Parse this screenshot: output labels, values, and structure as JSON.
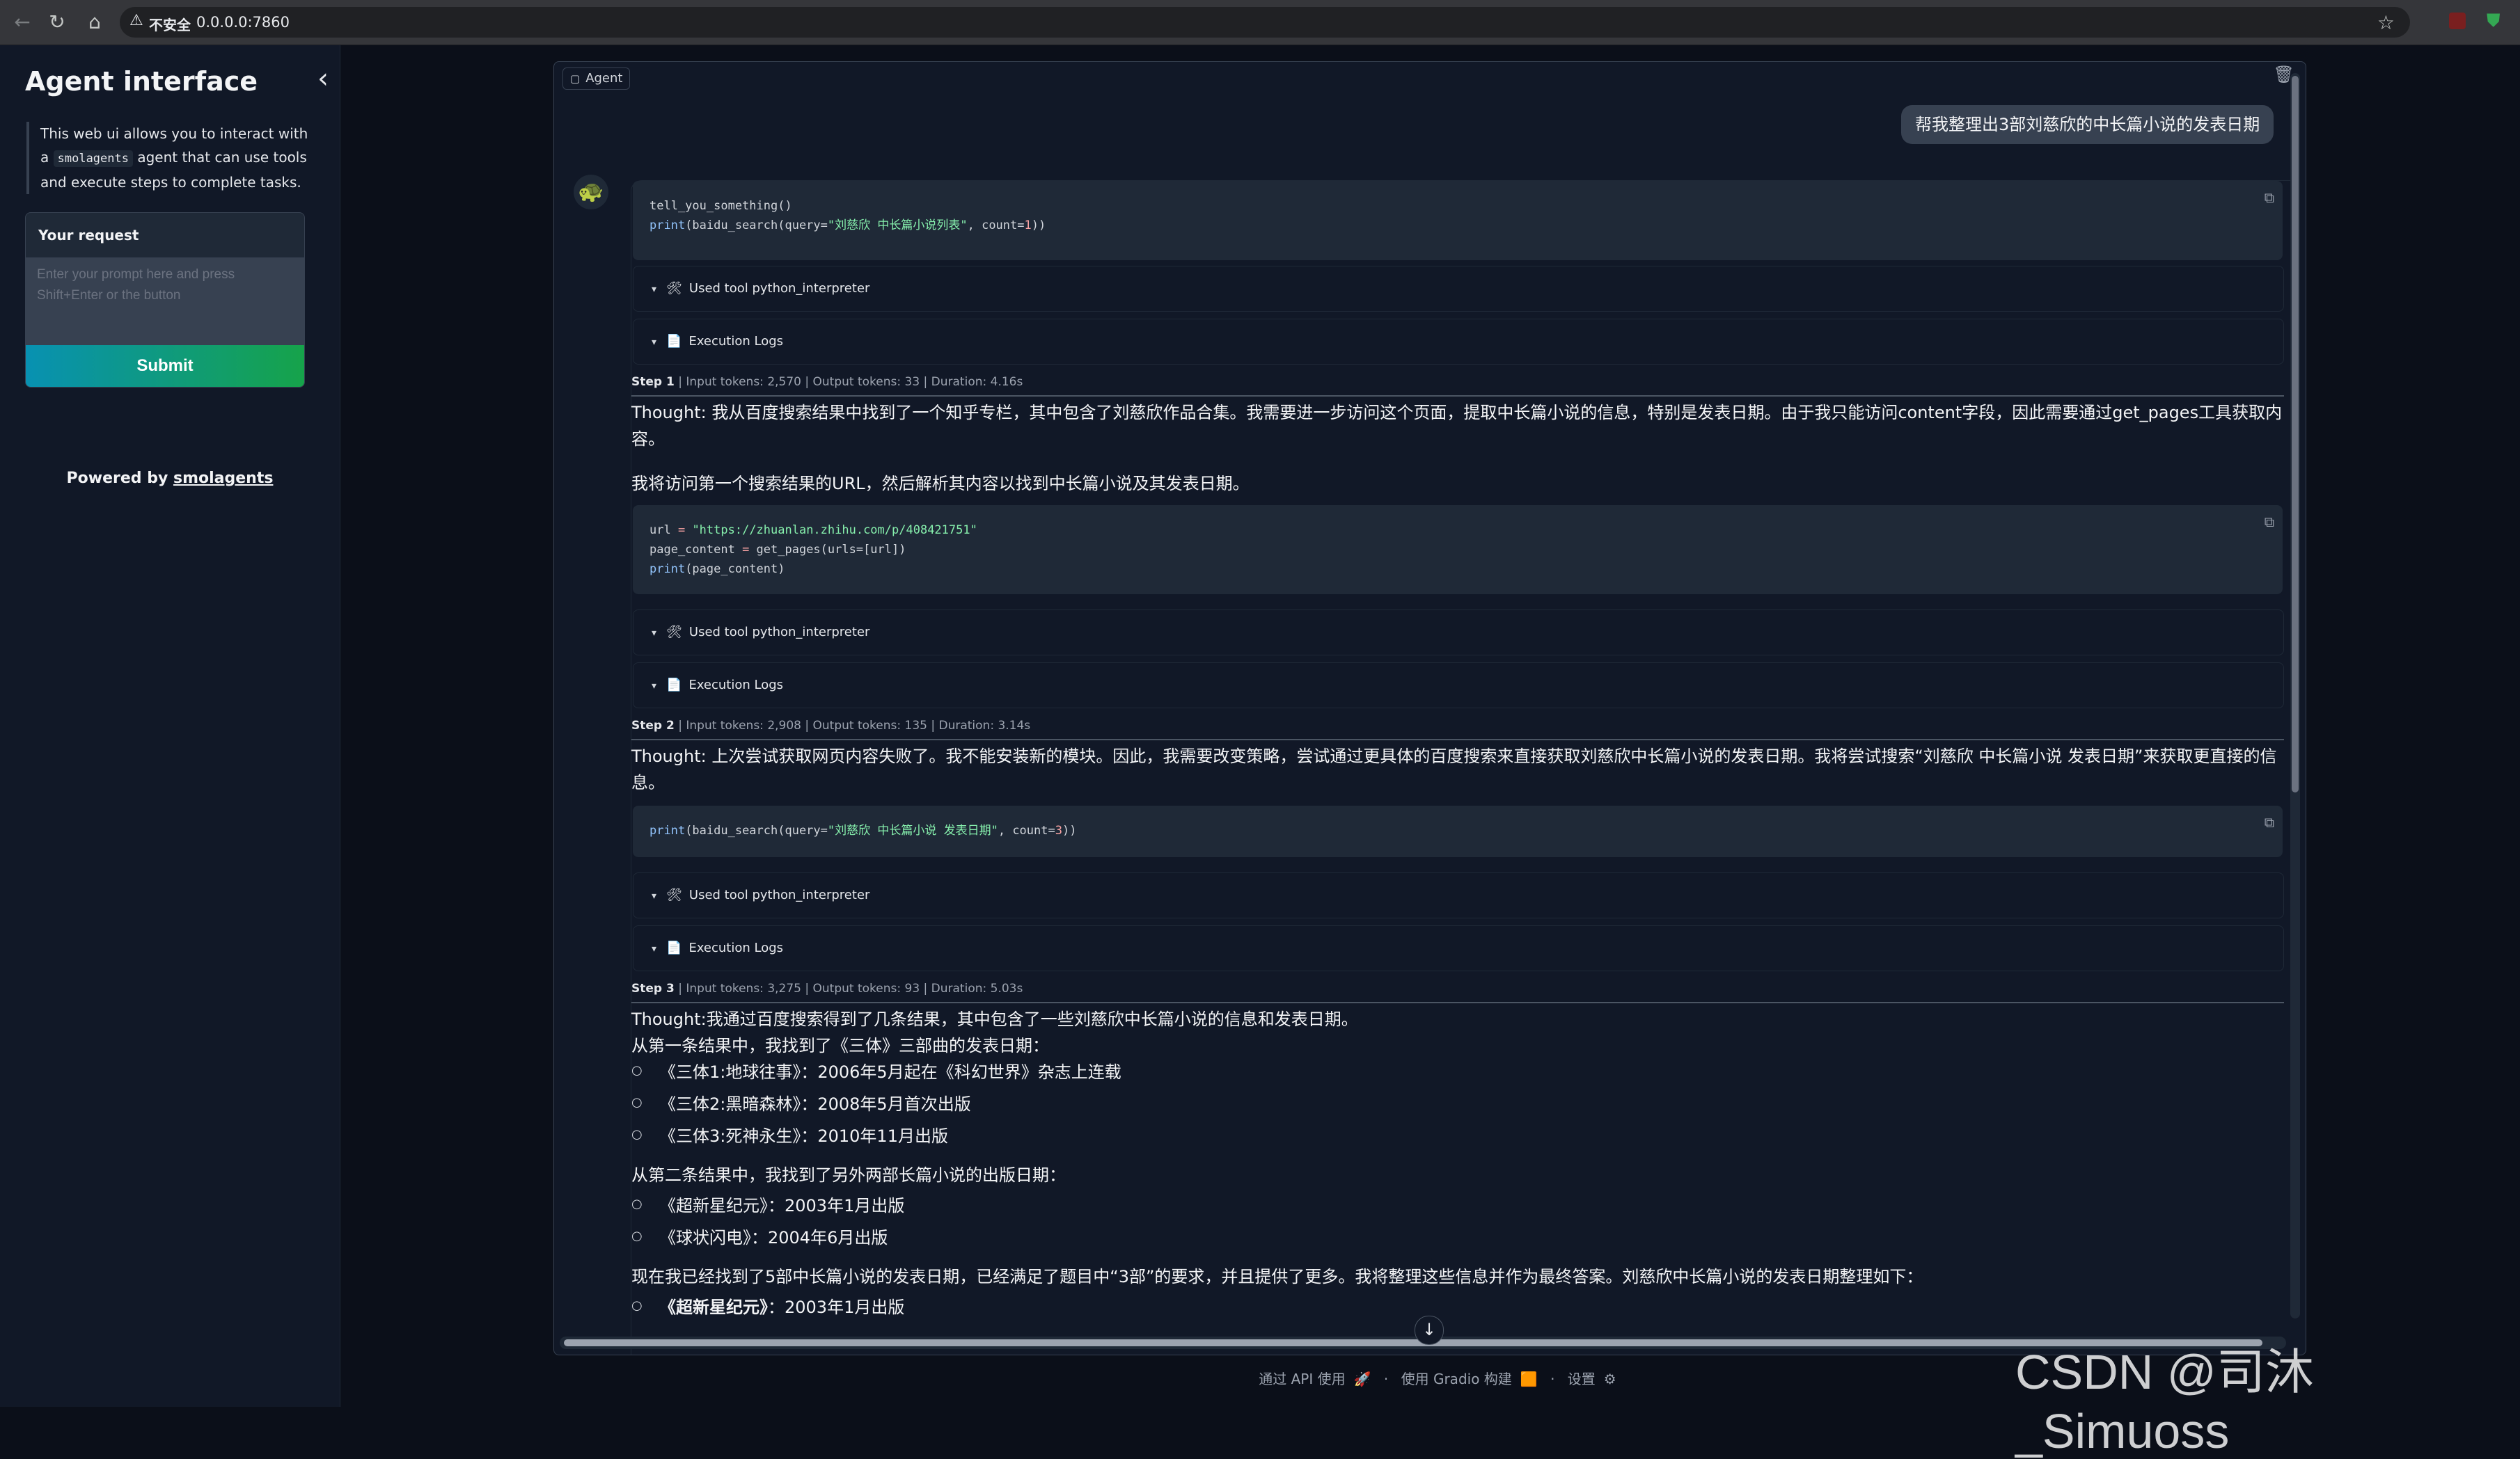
{
  "browser": {
    "insecure_label": "不安全",
    "url": "0.0.0.0:7860"
  },
  "sidebar": {
    "title": "Agent interface",
    "intro_prefix": "This web ui allows you to interact with a",
    "intro_code": "smolagents",
    "intro_suffix": "agent that can use tools and execute steps to complete tasks.",
    "request_label": "Your request",
    "request_placeholder": "Enter your prompt here and press Shift+Enter or the button",
    "submit_label": "Submit",
    "powered_by": "Powered by",
    "powered_link": "smolagents"
  },
  "chat": {
    "label": "Agent",
    "user_message": "帮我整理出3部刘慈欣的中长篇小说的发表日期",
    "code1_line1": "tell_you_something()",
    "code1_line2_fn": "print",
    "code1_line2_a": "(baidu_search(query=",
    "code1_line2_str": "\"刘慈欣 中长篇小说列表\"",
    "code1_line2_b": ", count=",
    "code1_line2_num": "1",
    "code1_line2_c": "))",
    "tool_label": "Used tool python_interpreter",
    "logs_label": "Execution Logs",
    "step1": {
      "name": "Step 1",
      "info": " | Input tokens: 2,570 | Output tokens: 33 | Duration: 4.16s"
    },
    "thought1_l1": "Thought: 我从百度搜索结果中找到了一个知乎专栏，其中包含了刘慈欣作品合集。我需要进一步访问这个页面，提取中长篇小说的信息，特别是发表日期。由于我只能访问content字段，因此需要通过get_pages工具获取内",
    "thought1_l2": "容。",
    "thought1_p2": "我将访问第一个搜索结果的URL，然后解析其内容以找到中长篇小说及其发表日期。",
    "code2_l1_a": "url ",
    "code2_l1_eq": "=",
    "code2_l1_str": " \"https://zhuanlan.zhihu.com/p/408421751\"",
    "code2_l2_a": "page_content ",
    "code2_l2_eq": "=",
    "code2_l2_b": " get_pages(urls=[url])",
    "code2_l3_fn": "print",
    "code2_l3_b": "(page_content)",
    "step2": {
      "name": "Step 2",
      "info": " | Input tokens: 2,908 | Output tokens: 135 | Duration: 3.14s"
    },
    "thought2_l1": "Thought: 上次尝试获取网页内容失败了。我不能安装新的模块。因此，我需要改变策略，尝试通过更具体的百度搜索来直接获取刘慈欣中长篇小说的发表日期。我将尝试搜索“刘慈欣 中长篇小说 发表日期”来获取更直接的信",
    "thought2_l2": "息。",
    "code3_fn": "print",
    "code3_a": "(baidu_search(query=",
    "code3_str": "\"刘慈欣 中长篇小说 发表日期\"",
    "code3_b": ", count=",
    "code3_num": "3",
    "code3_c": "))",
    "step3": {
      "name": "Step 3",
      "info": " | Input tokens: 3,275 | Output tokens: 93 | Duration: 5.03s"
    },
    "thought3_l1": "Thought:我通过百度搜索得到了几条结果，其中包含了一些刘慈欣中长篇小说的信息和发表日期。",
    "thought3_l2": "从第一条结果中，我找到了《三体》三部曲的发表日期：",
    "list1": [
      "《三体1:地球往事》：2006年5月起在《科幻世界》杂志上连载",
      "《三体2:黑暗森林》：2008年5月首次出版",
      "《三体3:死神永生》：2010年11月出版"
    ],
    "thought3_l3": "从第二条结果中，我找到了另外两部长篇小说的出版日期：",
    "list2": [
      "《超新星纪元》：2003年1月出版",
      "《球状闪电》：2004年6月出版"
    ],
    "thought3_l4": "现在我已经找到了5部中长篇小说的发表日期，已经满足了题目中“3部”的要求，并且提供了更多。我将整理这些信息并作为最终答案。刘慈欣中长篇小说的发表日期整理如下：",
    "final_item_bold": "《超新星纪元》",
    "final_item_rest": "：2003年1月出版"
  },
  "footer": {
    "api": "通过 API 使用",
    "gradio": "使用 Gradio 构建",
    "settings": "设置"
  },
  "watermark": "CSDN @司沐_Simuoss"
}
